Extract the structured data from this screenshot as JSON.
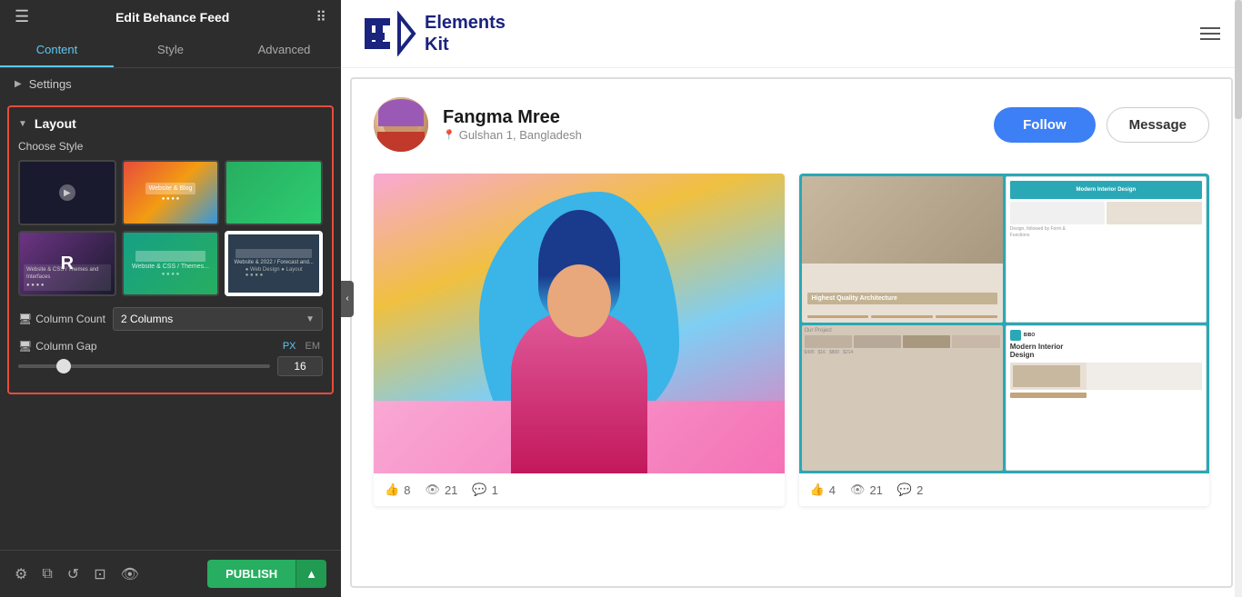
{
  "panel": {
    "title": "Edit Behance Feed",
    "tabs": [
      {
        "label": "Content",
        "active": true
      },
      {
        "label": "Style",
        "active": false
      },
      {
        "label": "Advanced",
        "active": false
      }
    ],
    "settings_label": "Settings",
    "layout": {
      "title": "Layout",
      "choose_style_label": "Choose Style",
      "styles": [
        {
          "id": "style-1",
          "selected": false
        },
        {
          "id": "style-2",
          "selected": false
        },
        {
          "id": "style-3",
          "selected": false
        },
        {
          "id": "style-4",
          "selected": false
        },
        {
          "id": "style-5",
          "selected": false
        },
        {
          "id": "style-6",
          "selected": true
        }
      ],
      "column_count_label": "Column Count",
      "column_count_value": "2 Columns",
      "column_gap_label": "Column Gap",
      "unit_px": "PX",
      "unit_em": "EM",
      "slider_value": "16"
    }
  },
  "footer": {
    "publish_label": "PUBLISH"
  },
  "preview": {
    "logo_line1": "Elements",
    "logo_line2": "Kit",
    "profile": {
      "name": "Fangma Mree",
      "location": "Gulshan 1, Bangladesh",
      "follow_label": "Follow",
      "message_label": "Message"
    },
    "feed_items": [
      {
        "likes": "8",
        "views": "21",
        "comments": "1"
      },
      {
        "likes": "4",
        "views": "21",
        "comments": "2"
      }
    ]
  }
}
